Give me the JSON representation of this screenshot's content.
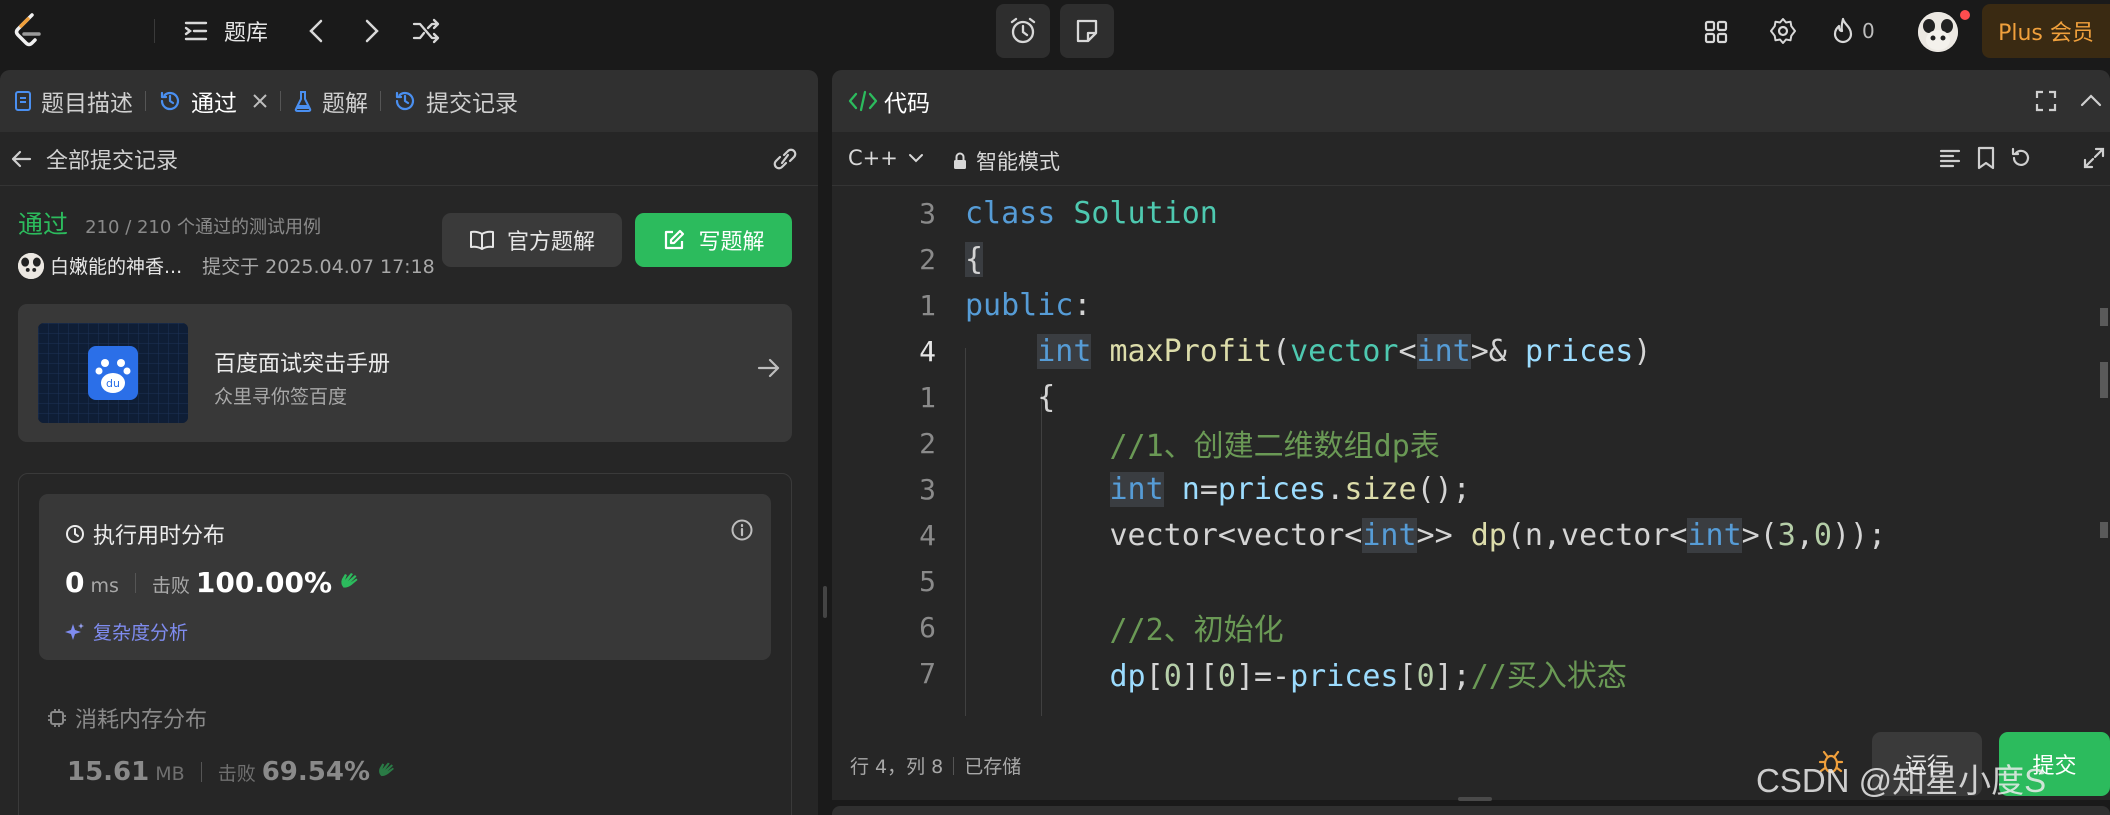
{
  "topbar": {
    "problem_bank_label": "题库",
    "streak_count": "0",
    "plus_label": "Plus 会员",
    "colors": {
      "accent": "#f0a03c",
      "badge": "#ff4d4f"
    }
  },
  "left_tabs": {
    "description": "题目描述",
    "accepted": "通过",
    "solutions": "题解",
    "submissions": "提交记录"
  },
  "left_sub": {
    "back_label": "全部提交记录"
  },
  "submission": {
    "status": "通过",
    "cases": "210 / 210 个通过的测试用例",
    "author": "白嫩能的神香...",
    "submitted_at": "提交于 2025.04.07 17:18",
    "official_solution_label": "官方题解",
    "write_solution_label": "写题解"
  },
  "promo": {
    "title": "百度面试突击手册",
    "subtitle": "众里寻你签百度",
    "logo_text": "du"
  },
  "runtime": {
    "title": "执行用时分布",
    "value": "0",
    "unit": "ms",
    "beat_label": "击败",
    "beat_value": "100.00%",
    "complexity_label": "复杂度分析"
  },
  "memory": {
    "title": "消耗内存分布",
    "value": "15.61",
    "unit": "MB",
    "beat_label": "击败",
    "beat_value": "69.54%"
  },
  "code_panel": {
    "title": "代码",
    "language": "C++",
    "mode": "智能模式",
    "cursor_position": "行 4，列 8",
    "saved_label": "已存储",
    "run_label": "运行",
    "submit_label": "提交"
  },
  "code_lines": [
    {
      "num": "3",
      "text": "class Solution"
    },
    {
      "num": "2",
      "text": "{"
    },
    {
      "num": "1",
      "text": "public:"
    },
    {
      "num": "4",
      "text": "    int maxProfit(vector<int>& prices)"
    },
    {
      "num": "1",
      "text": "    {"
    },
    {
      "num": "2",
      "text": "        //1、创建二维数组dp表"
    },
    {
      "num": "3",
      "text": "        int n=prices.size();"
    },
    {
      "num": "4",
      "text": "        vector<vector<int>> dp(n,vector<int>(3,0));"
    },
    {
      "num": "5",
      "text": ""
    },
    {
      "num": "6",
      "text": "        //2、初始化"
    },
    {
      "num": "7",
      "text": "        dp[0][0]=-prices[0];//买入状态"
    }
  ],
  "watermark": "CSDN @知星小度S"
}
